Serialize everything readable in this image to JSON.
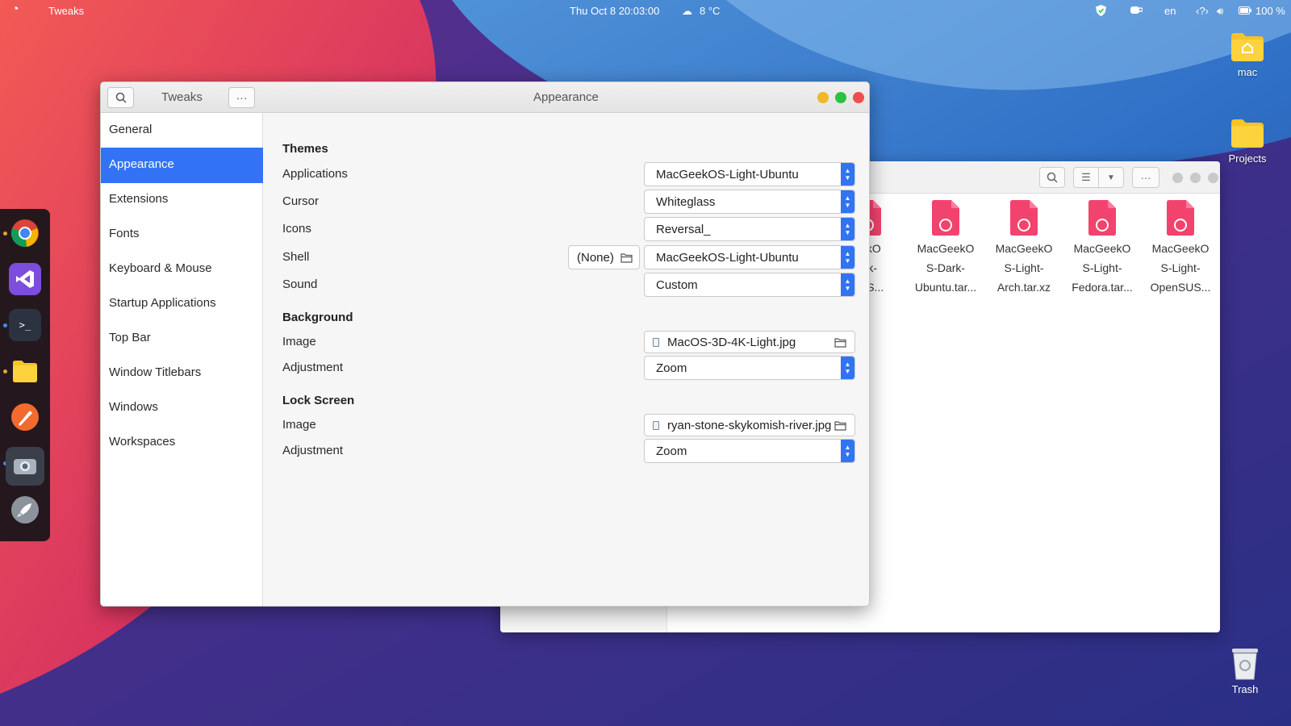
{
  "topbar": {
    "app_name": "Tweaks",
    "datetime": "Thu Oct 8  20:03:00",
    "weather": "8 °C",
    "language": "en",
    "battery": "100 %"
  },
  "desktop": {
    "icons": [
      {
        "label": "mac"
      },
      {
        "label": "Projects"
      },
      {
        "label": "Trash"
      }
    ]
  },
  "file_manager": {
    "files": [
      {
        "line1": "eekO",
        "line2": "ark-",
        "line3": "SUS..."
      },
      {
        "line1": "MacGeekO",
        "line2": "S-Dark-",
        "line3": "Ubuntu.tar..."
      },
      {
        "line1": "MacGeekO",
        "line2": "S-Light-",
        "line3": "Arch.tar.xz"
      },
      {
        "line1": "MacGeekO",
        "line2": "S-Light-",
        "line3": "Fedora.tar..."
      },
      {
        "line1": "MacGeekO",
        "line2": "S-Light-",
        "line3": "OpenSUS..."
      }
    ],
    "more_label": "···"
  },
  "tweaks": {
    "app_title": "Tweaks",
    "menu_label": "···",
    "page_title": "Appearance",
    "sidebar": [
      {
        "label": "General"
      },
      {
        "label": "Appearance"
      },
      {
        "label": "Extensions"
      },
      {
        "label": "Fonts"
      },
      {
        "label": "Keyboard & Mouse"
      },
      {
        "label": "Startup Applications"
      },
      {
        "label": "Top Bar"
      },
      {
        "label": "Window Titlebars"
      },
      {
        "label": "Windows"
      },
      {
        "label": "Workspaces"
      }
    ],
    "themes": {
      "heading": "Themes",
      "applications": {
        "label": "Applications",
        "value": "MacGeekOS-Light-Ubuntu"
      },
      "cursor": {
        "label": "Cursor",
        "value": "Whiteglass"
      },
      "icons": {
        "label": "Icons",
        "value": "Reversal_"
      },
      "shell": {
        "label": "Shell",
        "file": "(None)",
        "value": "MacGeekOS-Light-Ubuntu"
      },
      "sound": {
        "label": "Sound",
        "value": "Custom"
      }
    },
    "background": {
      "heading": "Background",
      "image": {
        "label": "Image",
        "value": "MacOS-3D-4K-Light.jpg"
      },
      "adjustment": {
        "label": "Adjustment",
        "value": "Zoom"
      }
    },
    "lock_screen": {
      "heading": "Lock Screen",
      "image": {
        "label": "Image",
        "value": "ryan-stone-skykomish-river.jpg"
      },
      "adjustment": {
        "label": "Adjustment",
        "value": "Zoom"
      }
    }
  },
  "colors": {
    "accent": "#3273f6",
    "close": "#f04e4e",
    "minimize": "#f2b62b",
    "maximize": "#2cc13f"
  }
}
